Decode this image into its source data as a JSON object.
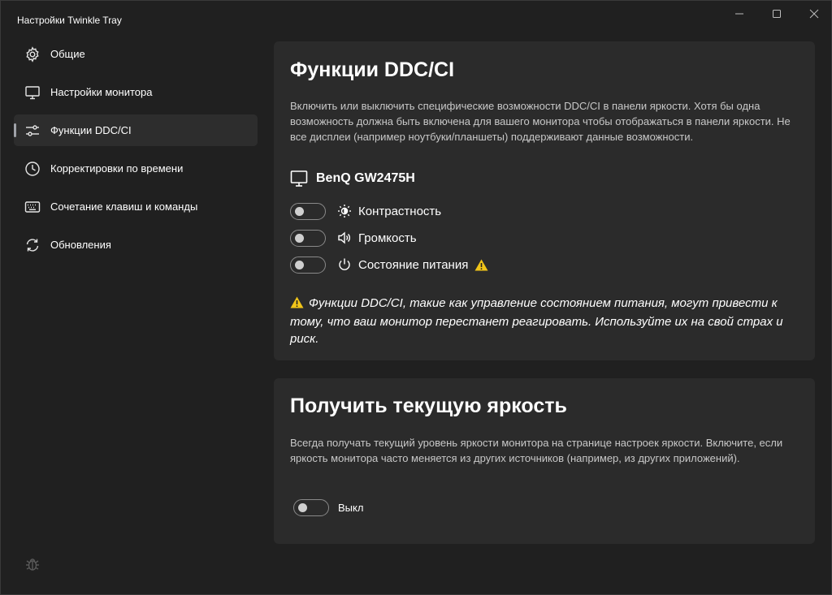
{
  "window": {
    "title": "Настройки Twinkle Tray"
  },
  "sidebar": {
    "items": [
      {
        "label": "Общие",
        "icon": "gear-icon"
      },
      {
        "label": "Настройки монитора",
        "icon": "monitor-icon"
      },
      {
        "label": "Функции DDC/CI",
        "icon": "sliders-icon",
        "active": true
      },
      {
        "label": "Корректировки по времени",
        "icon": "clock-icon"
      },
      {
        "label": "Сочетание клавиш и команды",
        "icon": "keyboard-icon"
      },
      {
        "label": "Обновления",
        "icon": "refresh-icon"
      }
    ],
    "footer_icon": "bug-icon"
  },
  "ddc_card": {
    "title": "Функции DDC/CI",
    "description": "Включить или выключить специфические возможности DDC/CI в панели яркости. Хотя бы одна возможность должна быть включена для вашего монитора чтобы отображаться в панели яркости. Не все дисплеи (например ноутбуки/планшеты) поддерживают данные возможности.",
    "monitor_name": "BenQ GW2475H",
    "features": [
      {
        "label": "Контрастность",
        "icon": "contrast-icon",
        "enabled": false
      },
      {
        "label": "Громкость",
        "icon": "volume-icon",
        "enabled": false
      },
      {
        "label": "Состояние питания",
        "icon": "power-icon",
        "enabled": false,
        "warning": true
      }
    ],
    "warning": "Функции DDC/CI, такие как управление состоянием питания, могут привести к тому, что ваш монитор перестанет реагировать. Используйте их на свой страх и риск."
  },
  "brightness_card": {
    "title": "Получить текущую яркость",
    "description": "Всегда получать текущий уровень яркости монитора на странице настроек яркости. Включите, если яркость монитора часто меняется из других источников (например, из других приложений).",
    "toggle_state": "Выкл",
    "enabled": false
  },
  "colors": {
    "background": "#202020",
    "card": "#2b2b2b",
    "warning": "#f0c419"
  }
}
